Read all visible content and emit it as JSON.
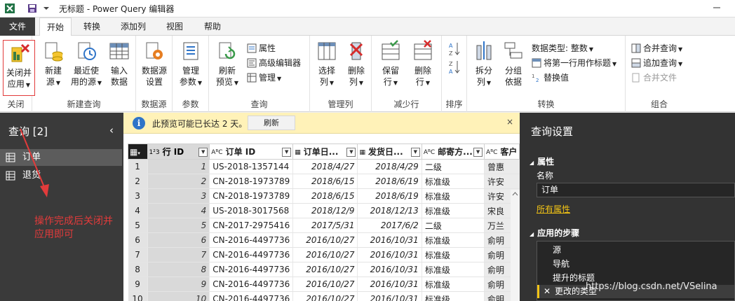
{
  "window": {
    "title": "无标题 - Power Query 编辑器"
  },
  "menu": {
    "file": "文件",
    "home": "开始",
    "transform": "转换",
    "add_column": "添加列",
    "view": "视图",
    "help": "帮助"
  },
  "ribbon": {
    "close": {
      "btn_line1": "关闭并",
      "btn_line2": "应用",
      "group": "关闭"
    },
    "new_query": {
      "new_source_1": "新建",
      "new_source_2": "源",
      "recent_1": "最近使",
      "recent_2": "用的源",
      "input_1": "输入",
      "input_2": "数据",
      "group": "新建查询"
    },
    "datasource": {
      "btn_1": "数据源",
      "btn_2": "设置",
      "group": "数据源"
    },
    "params": {
      "btn_1": "管理",
      "btn_2": "参数",
      "group": "参数"
    },
    "query": {
      "refresh_1": "刷新",
      "refresh_2": "预览",
      "properties": "属性",
      "advanced": "高级编辑器",
      "manage": "管理",
      "group": "查询"
    },
    "columns": {
      "choose_1": "选择",
      "choose_2": "列",
      "remove_1": "删除",
      "remove_2": "列",
      "group": "管理列"
    },
    "rows": {
      "keep_1": "保留",
      "keep_2": "行",
      "remove_1": "删除",
      "remove_2": "行",
      "group": "减少行"
    },
    "sort": {
      "group": "排序"
    },
    "transform": {
      "split_1": "拆分",
      "split_2": "列",
      "groupby_1": "分组",
      "groupby_2": "依据",
      "datatype": "数据类型: 整数",
      "first_row": "将第一行用作标题",
      "replace": "替换值",
      "group": "转换"
    },
    "combine": {
      "merge": "合并查询",
      "append": "追加查询",
      "files": "合并文件",
      "group": "组合"
    }
  },
  "queries": {
    "header": "查询 [2]",
    "items": [
      "订单",
      "退货"
    ]
  },
  "annotation": "操作完成后关闭并应用即可",
  "infobar": {
    "message": "此预览可能已长达 2 天。",
    "refresh": "刷新",
    "close": "×"
  },
  "table": {
    "columns": [
      {
        "type": "1²3",
        "name": "行 ID"
      },
      {
        "type": "AᴮC",
        "name": "订单 ID"
      },
      {
        "type": "▦",
        "name": "订单日..."
      },
      {
        "type": "▦",
        "name": "发货日..."
      },
      {
        "type": "AᴮC",
        "name": "邮寄方..."
      },
      {
        "type": "AᴮC",
        "name": "客户"
      }
    ],
    "rows": [
      [
        "1",
        "1",
        "US-2018-1357144",
        "2018/4/27",
        "2018/4/29",
        "二级",
        "曾惠"
      ],
      [
        "2",
        "2",
        "CN-2018-1973789",
        "2018/6/15",
        "2018/6/19",
        "标准级",
        "许安"
      ],
      [
        "3",
        "3",
        "CN-2018-1973789",
        "2018/6/15",
        "2018/6/19",
        "标准级",
        "许安"
      ],
      [
        "4",
        "4",
        "US-2018-3017568",
        "2018/12/9",
        "2018/12/13",
        "标准级",
        "宋良"
      ],
      [
        "5",
        "5",
        "CN-2017-2975416",
        "2017/5/31",
        "2017/6/2",
        "二级",
        "万兰"
      ],
      [
        "6",
        "6",
        "CN-2016-4497736",
        "2016/10/27",
        "2016/10/31",
        "标准级",
        "俞明"
      ],
      [
        "7",
        "7",
        "CN-2016-4497736",
        "2016/10/27",
        "2016/10/31",
        "标准级",
        "俞明"
      ],
      [
        "8",
        "8",
        "CN-2016-4497736",
        "2016/10/27",
        "2016/10/31",
        "标准级",
        "俞明"
      ],
      [
        "9",
        "9",
        "CN-2016-4497736",
        "2016/10/27",
        "2016/10/31",
        "标准级",
        "俞明"
      ],
      [
        "10",
        "10",
        "CN-2016-4497736",
        "2016/10/27",
        "2016/10/31",
        "标准级",
        "俞明"
      ]
    ]
  },
  "settings": {
    "header": "查询设置",
    "props_title": "属性",
    "name_label": "名称",
    "name_value": "订单",
    "all_props": "所有属性",
    "steps_title": "应用的步骤",
    "steps": [
      "源",
      "导航",
      "提升的标题",
      "更改的类型"
    ]
  },
  "watermark": "https://blog.csdn.net/VSelina",
  "colors": {
    "accent": "#f2c315",
    "highlight_border": "#e23b3b",
    "dark_pane": "#333333",
    "infobar": "#fff2b8"
  }
}
